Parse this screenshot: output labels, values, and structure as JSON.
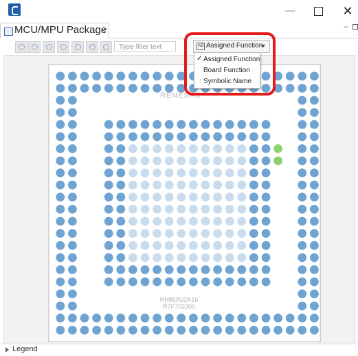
{
  "window": {
    "app_icon": "app-logo-icon",
    "minimize": "—",
    "close": "✕"
  },
  "tab": {
    "title": "MCU/MPU Package",
    "close": "×"
  },
  "toolbar": {
    "filter_placeholder": "Type filter text"
  },
  "dropdown": {
    "icon_text": "AB",
    "label": "Assigned Function"
  },
  "menu": {
    "items": [
      {
        "label": "Assigned Function",
        "checked": true,
        "check": "✓"
      },
      {
        "label": "Board Function",
        "checked": false,
        "check": ""
      },
      {
        "label": "Symbolic Name",
        "checked": false,
        "check": ""
      }
    ]
  },
  "package": {
    "brand": "RENESAS",
    "part_line1": "RH850U2A16",
    "part_line2": "R7F702300"
  },
  "legend": {
    "label": "Legend"
  },
  "colors": {
    "pin": "#6fa4d2",
    "pin_light": "#c8dcee",
    "assigned": "#8ed16f",
    "highlight": "#e31b1b"
  }
}
